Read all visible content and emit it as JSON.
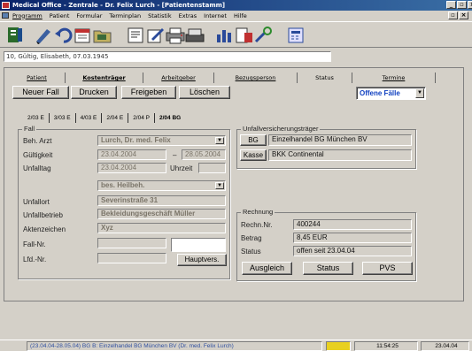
{
  "window": {
    "title": "Medical Office - Zentrale - Dr. Felix Lurch - [Patientenstamm]"
  },
  "menu": [
    "Programm",
    "Patient",
    "Formular",
    "Terminplan",
    "Statistik",
    "Extras",
    "Internet",
    "Hilfe"
  ],
  "toolbar_icons": [
    "patient-icon",
    "edit-icon",
    "undo-icon",
    "calendar-icon",
    "folder-icon",
    "book-icon",
    "notes-icon",
    "print-icon",
    "scan-icon",
    "chart-icon",
    "document-icon",
    "tools-icon",
    "calculator-icon"
  ],
  "patient_line": "10, Gültig, Elisabeth, 07.03.1945",
  "tabs_main": [
    {
      "label": "Patient"
    },
    {
      "label": "Kostenträger"
    },
    {
      "label": "Arbeitgeber"
    },
    {
      "label": "Bezugsperson"
    },
    {
      "label": "Status"
    },
    {
      "label": "Termine"
    }
  ],
  "actions": {
    "neuer_fall": "Neuer Fall",
    "drucken": "Drucken",
    "freigeben": "Freigeben",
    "loeschen": "Löschen"
  },
  "filter": {
    "value": "Offene Fälle"
  },
  "quarter_tabs": [
    "2/03 E",
    "3/03 E",
    "4/03 E",
    "2/04 E",
    "2/04 P",
    "2/04 BG"
  ],
  "fall": {
    "group_label": "Fall",
    "beh_arzt_label": "Beh. Arzt",
    "beh_arzt": "Lurch, Dr. med. Felix",
    "gueltigkeit_label": "Gültigkeit",
    "gueltig_von": "23.04.2004",
    "dash": "–",
    "gueltig_bis": "28.05.2004",
    "unfalltag_label": "Unfalltag",
    "unfalltag": "23.04.2004",
    "uhrzeit_label": "Uhrzeit",
    "uhrzeit": "",
    "art": "bes. Heilbeh.",
    "unfallort_label": "Unfallort",
    "unfallort": "Severinstraße 31",
    "unfallbetrieb_label": "Unfallbetrieb",
    "unfallbetrieb": "Bekleidungsgeschäft Müller",
    "aktenzeichen_label": "Aktenzeichen",
    "aktenzeichen": "Xyz",
    "fallnr_label": "Fall-Nr.",
    "fallnr": "",
    "lfdnr_label": "Lfd.-Nr.",
    "lfdnr": "",
    "hauptvers_label": "Hauptvers."
  },
  "versicherung": {
    "group_label": "Unfallversicherungsträger",
    "bg_button": "BG",
    "bg_value": "Einzelhandel BG München BV",
    "kasse_button": "Kasse",
    "kasse_value": "BKK Continental"
  },
  "rechnung": {
    "group_label": "Rechnung",
    "nr_label": "Rechn.Nr.",
    "nr": "400244",
    "betrag_label": "Betrag",
    "betrag": "8,45 EUR",
    "status_label": "Status",
    "status": "offen seit 23.04.04",
    "ausgleich": "Ausgleich",
    "status_btn": "Status",
    "pvs": "PVS"
  },
  "statusbar": {
    "info": "(23.04.04-28.05.04) BG B: Einzelhandel BG München BV (Dr. med. Felix Lurch)",
    "time": "11:54:25",
    "date": "23.04.04"
  }
}
